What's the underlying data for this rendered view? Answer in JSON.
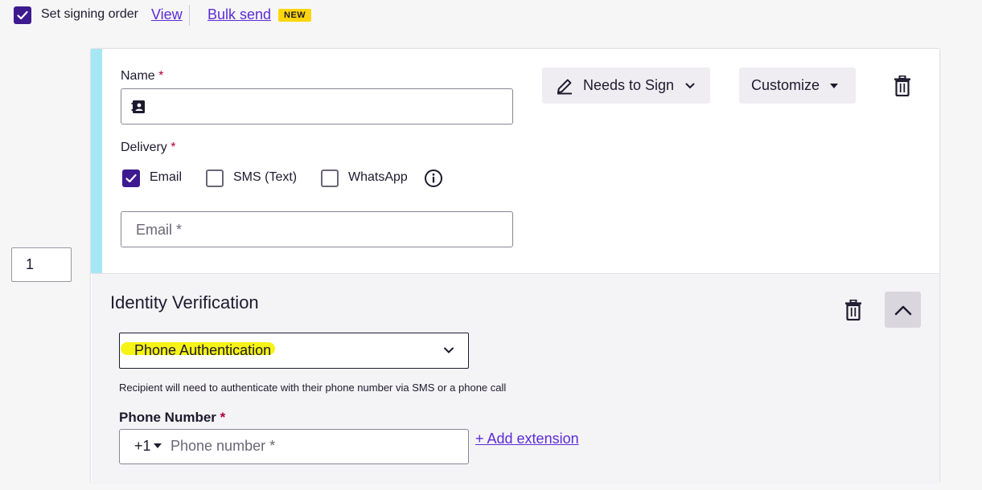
{
  "toolbar": {
    "signing_order_label": "Set signing order",
    "signing_order_checked": true,
    "view_link": "View",
    "bulk_send_link": "Bulk send",
    "new_badge": "NEW"
  },
  "recipient": {
    "order_value": "1",
    "name_label": "Name",
    "required_mark": "*",
    "name_value": "",
    "delivery_label": "Delivery",
    "delivery_options": [
      {
        "label": "Email",
        "checked": true
      },
      {
        "label": "SMS (Text)",
        "checked": false
      },
      {
        "label": "WhatsApp",
        "checked": false
      }
    ],
    "email_placeholder": "Email *",
    "role_button": "Needs to Sign",
    "customize_button": "Customize"
  },
  "identity": {
    "title": "Identity Verification",
    "method_selected": "Phone Authentication",
    "helper_text": "Recipient will need to authenticate with their phone number via SMS or a phone call",
    "phone_label": "Phone Number",
    "country_code": "+1",
    "phone_placeholder": "Phone number *",
    "add_extension_link": "+ Add extension"
  },
  "colors": {
    "accent_purple": "#3d1a8f",
    "link_purple": "#5b2bd6",
    "card_accent": "#a6e7f5",
    "badge_yellow": "#ffd60a",
    "highlight_yellow": "#f6f20a",
    "required_red": "#b3003a"
  },
  "icons": [
    "check-icon",
    "contact-card-icon",
    "info-icon",
    "pencil-icon",
    "chevron-down-icon",
    "caret-down-icon",
    "trash-icon",
    "chevron-up-icon"
  ]
}
